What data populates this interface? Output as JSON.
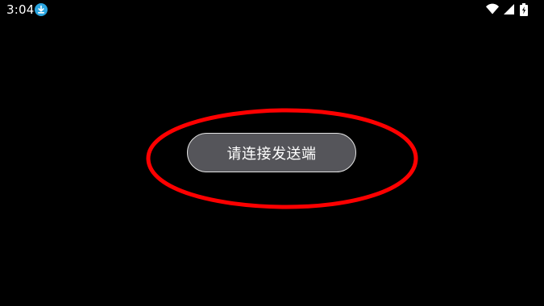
{
  "status_bar": {
    "time": "3:04",
    "icons": [
      "download-icon",
      "wifi-icon",
      "signal-icon",
      "battery-charging-icon"
    ],
    "accent_color": "#2aa5e0"
  },
  "main": {
    "connect_button_label": "请连接发送端"
  },
  "annotation": {
    "shape": "ellipse",
    "color": "#ff0000"
  }
}
